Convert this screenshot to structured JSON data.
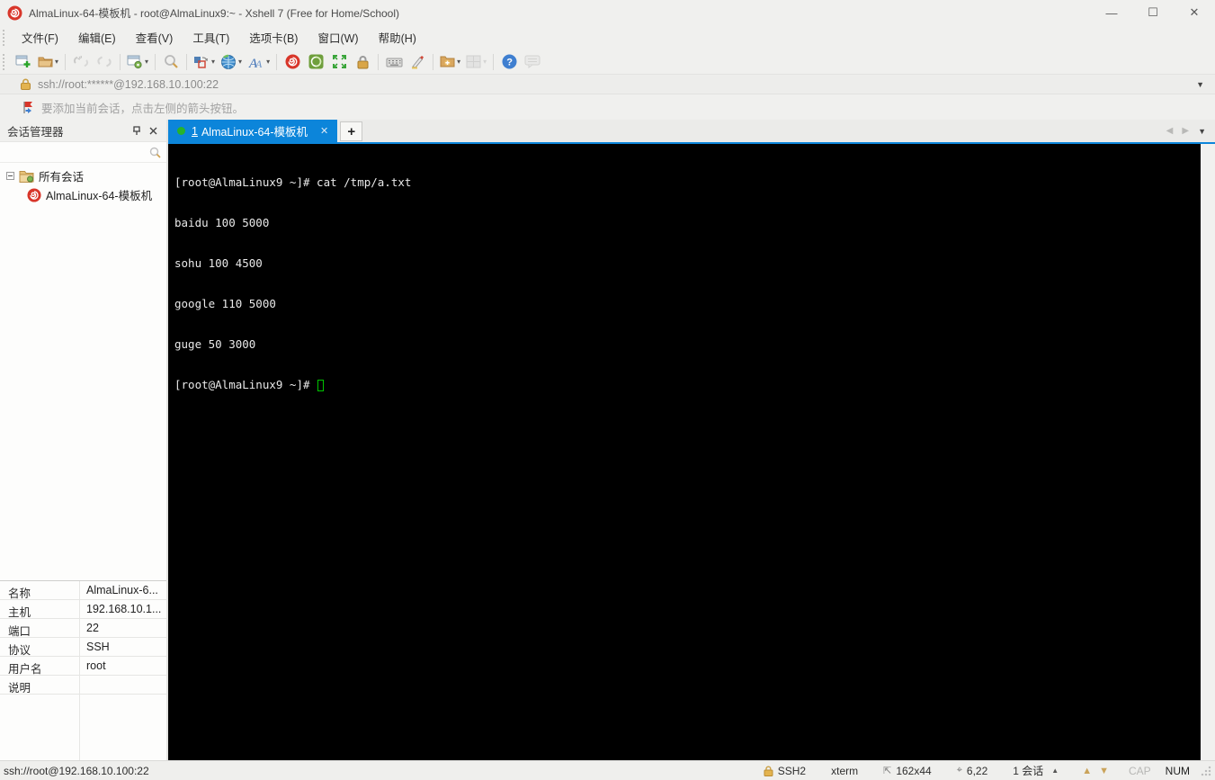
{
  "window": {
    "title": "AlmaLinux-64-模板机 - root@AlmaLinux9:~ - Xshell 7 (Free for Home/School)",
    "controls": {
      "minimize": "—",
      "maximize": "☐",
      "close": "✕"
    }
  },
  "menu": {
    "items": [
      {
        "label": "文件(F)"
      },
      {
        "label": "编辑(E)"
      },
      {
        "label": "查看(V)"
      },
      {
        "label": "工具(T)"
      },
      {
        "label": "选项卡(B)"
      },
      {
        "label": "窗口(W)"
      },
      {
        "label": "帮助(H)"
      }
    ]
  },
  "toolbar": {
    "icons": [
      "new-session-icon",
      "open-folder-icon",
      "disconnect-icon",
      "reconnect-icon",
      "session-properties-icon",
      "find-icon",
      "layout-icon",
      "web-icon",
      "font-icon",
      "xshell-icon",
      "xftp-icon",
      "fullscreen-icon",
      "lock-screen-icon",
      "virtual-keyboard-icon",
      "highlight-pen-icon",
      "new-folder-icon",
      "tile-windows-icon",
      "help-icon",
      "feedback-icon"
    ]
  },
  "address_bar": {
    "value": "ssh://root:******@192.168.10.100:22"
  },
  "info_bar": {
    "text": "要添加当前会话，点击左侧的箭头按钮。"
  },
  "session_manager": {
    "title": "会话管理器",
    "search_value": "",
    "tree": {
      "root": {
        "label": "所有会话"
      },
      "child": {
        "label": "AlmaLinux-64-模板机"
      }
    }
  },
  "tabs": {
    "active": {
      "index": "1",
      "label": "AlmaLinux-64-模板机",
      "close": "✕"
    },
    "new_tab": "+"
  },
  "terminal": {
    "lines": [
      "[root@AlmaLinux9 ~]# cat /tmp/a.txt",
      "baidu 100 5000",
      "sohu 100 4500",
      "google 110 5000",
      "guge 50 3000",
      "[root@AlmaLinux9 ~]# "
    ]
  },
  "properties": {
    "rows": [
      {
        "label": "名称",
        "value": "AlmaLinux-6..."
      },
      {
        "label": "主机",
        "value": "192.168.10.1..."
      },
      {
        "label": "端口",
        "value": "22"
      },
      {
        "label": "协议",
        "value": "SSH"
      },
      {
        "label": "用户名",
        "value": "root"
      },
      {
        "label": "说明",
        "value": ""
      }
    ]
  },
  "status_bar": {
    "left": "ssh://root@192.168.10.100:22",
    "protocol": "SSH2",
    "term_type": "xterm",
    "size": "162x44",
    "cursor_pos": "6,22",
    "sessions": "1 会话",
    "cap": "CAP",
    "num": "NUM"
  },
  "colors": {
    "tab_active": "#0c85da",
    "terminal_bg": "#000000",
    "terminal_fg": "#e9e9e9",
    "cursor_green": "#00c400",
    "connected_dot": "#27b32b",
    "xshell_red": "#d8362a"
  }
}
